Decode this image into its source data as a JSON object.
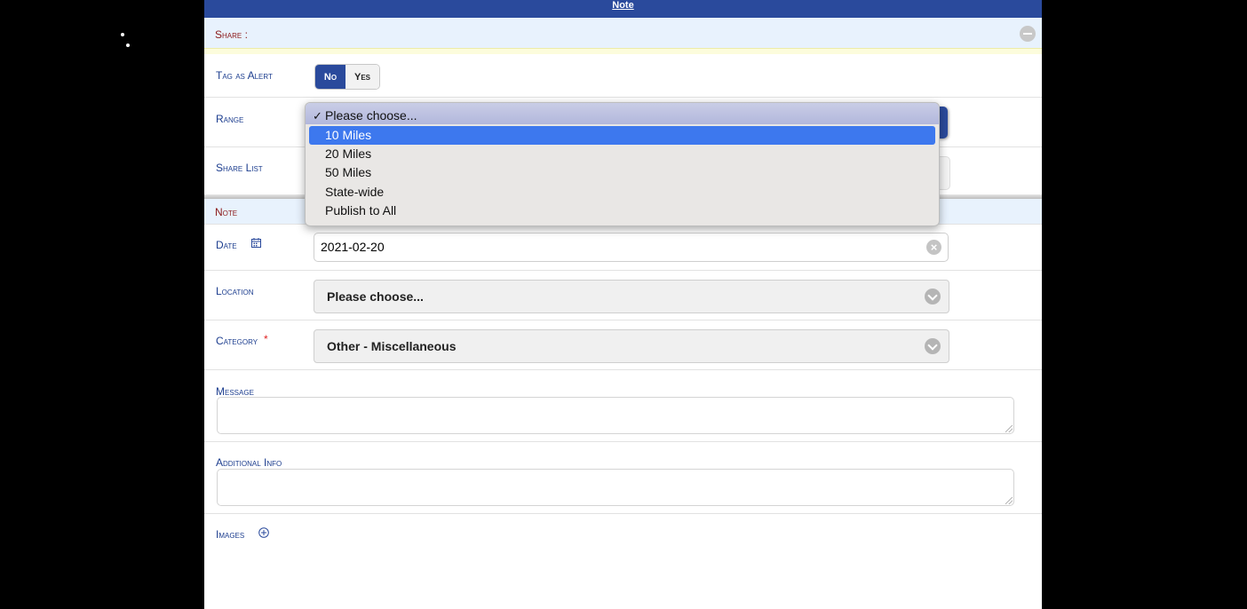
{
  "window": {
    "title": "Note"
  },
  "share_section": {
    "title": "Share :",
    "tag_alert": {
      "label": "Tag as Alert",
      "options": [
        "No",
        "Yes"
      ],
      "selected": "No"
    },
    "range": {
      "label": "Range"
    },
    "share_list": {
      "label": "Share List"
    }
  },
  "range_dropdown": {
    "options": [
      "Please choose...",
      "10 Miles",
      "20 Miles",
      "50 Miles",
      "State-wide",
      "Publish to All"
    ],
    "checked": "Please choose...",
    "highlighted": "10 Miles",
    "checkmark": "✓"
  },
  "note_section": {
    "title": "Note",
    "date": {
      "label": "Date",
      "value": "2021-02-20",
      "icon": "calendar-icon"
    },
    "location": {
      "label": "Location",
      "value": "Please choose..."
    },
    "category": {
      "label": "Category",
      "required_mark": "*",
      "value": "Other - Miscellaneous"
    },
    "message": {
      "label": "Message",
      "value": ""
    },
    "additional_info": {
      "label": "Additional Info",
      "value": ""
    },
    "images": {
      "label": "Images",
      "icon": "plus-circle-icon"
    }
  },
  "colors": {
    "header_bg": "#2a4a9c",
    "section_bg": "#e8f2fd",
    "label": "#1d3e8f",
    "highlight": "#3d78ee",
    "required": "#e02020"
  }
}
